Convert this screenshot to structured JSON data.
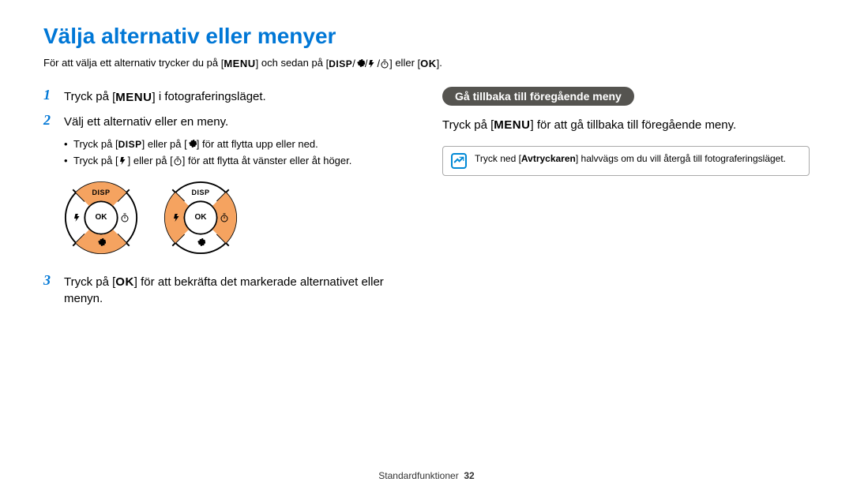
{
  "title": "Välja alternativ eller menyer",
  "intro": {
    "pre": "För att välja ett alternativ trycker du på ",
    "menu": "MENU",
    "mid": " och sedan på ",
    "disp": "DISP",
    "tail": " eller ",
    "ok": "OK",
    "end": "."
  },
  "steps": {
    "s1": {
      "num": "1",
      "pre": "Tryck på ",
      "menu": "MENU",
      "post": " i fotograferingsläget."
    },
    "s2": {
      "num": "2",
      "text": "Välj ett alternativ eller en meny."
    },
    "s2a": {
      "pre": "Tryck på ",
      "disp": "DISP",
      "mid": " eller på ",
      "post": " för att flytta upp eller ned."
    },
    "s2b": {
      "pre": "Tryck på ",
      "mid": " eller på ",
      "post": " för att flytta åt vänster eller åt höger."
    },
    "s3": {
      "num": "3",
      "pre": "Tryck på ",
      "ok": "OK",
      "post": " för att bekräfta det markerade alternativet eller menyn."
    }
  },
  "dial": {
    "disp": "DISP",
    "ok": "OK"
  },
  "right": {
    "pill": "Gå tillbaka till föregående meny",
    "text_pre": "Tryck på ",
    "menu": "MENU",
    "text_post": " för att gå tillbaka till föregående meny.",
    "note_pre": "Tryck ned ",
    "note_bold": "Avtryckaren",
    "note_post": " halvvägs om du vill återgå till fotograferingsläget."
  },
  "footer": {
    "label": "Standardfunktioner",
    "page": "32"
  }
}
